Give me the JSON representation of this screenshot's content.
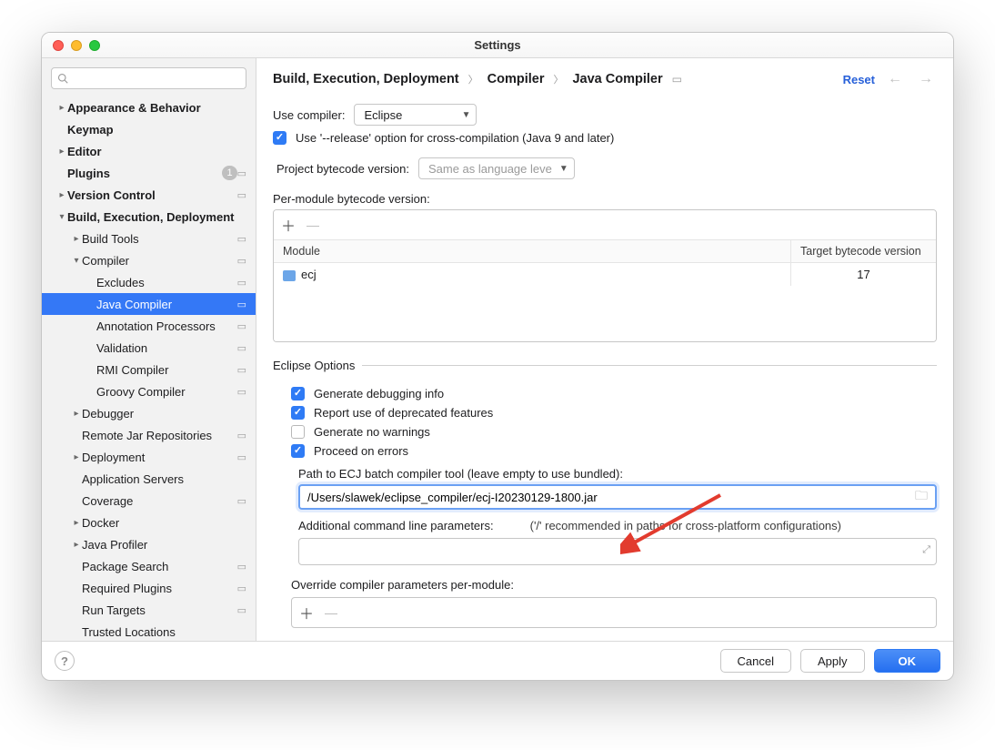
{
  "window": {
    "title": "Settings"
  },
  "crumbs": {
    "a": "Build, Execution, Deployment",
    "b": "Compiler",
    "c": "Java Compiler",
    "reset": "Reset"
  },
  "sidebar": {
    "search_placeholder": "",
    "items": [
      {
        "label": "Appearance & Behavior",
        "bold": true,
        "chev": "right",
        "indent": 0
      },
      {
        "label": "Keymap",
        "bold": true,
        "indent": 0
      },
      {
        "label": "Editor",
        "bold": true,
        "chev": "right",
        "indent": 0
      },
      {
        "label": "Plugins",
        "bold": true,
        "badge": "1",
        "cfg": true,
        "indent": 0
      },
      {
        "label": "Version Control",
        "bold": true,
        "cfg": true,
        "chev": "right",
        "indent": 0
      },
      {
        "label": "Build, Execution, Deployment",
        "bold": true,
        "chev": "down",
        "indent": 0
      },
      {
        "label": "Build Tools",
        "cfg": true,
        "chev": "right",
        "indent": 1
      },
      {
        "label": "Compiler",
        "cfg": true,
        "chev": "down",
        "indent": 1
      },
      {
        "label": "Excludes",
        "cfg": true,
        "indent": 2
      },
      {
        "label": "Java Compiler",
        "cfg": true,
        "indent": 2,
        "selected": true
      },
      {
        "label": "Annotation Processors",
        "cfg": true,
        "indent": 2
      },
      {
        "label": "Validation",
        "cfg": true,
        "indent": 2
      },
      {
        "label": "RMI Compiler",
        "cfg": true,
        "indent": 2
      },
      {
        "label": "Groovy Compiler",
        "cfg": true,
        "indent": 2
      },
      {
        "label": "Debugger",
        "chev": "right",
        "indent": 1
      },
      {
        "label": "Remote Jar Repositories",
        "cfg": true,
        "indent": 1
      },
      {
        "label": "Deployment",
        "cfg": true,
        "chev": "right",
        "indent": 1
      },
      {
        "label": "Application Servers",
        "indent": 1
      },
      {
        "label": "Coverage",
        "cfg": true,
        "indent": 1
      },
      {
        "label": "Docker",
        "chev": "right",
        "indent": 1
      },
      {
        "label": "Java Profiler",
        "chev": "right",
        "indent": 1
      },
      {
        "label": "Package Search",
        "cfg": true,
        "indent": 1
      },
      {
        "label": "Required Plugins",
        "cfg": true,
        "indent": 1
      },
      {
        "label": "Run Targets",
        "cfg": true,
        "indent": 1
      },
      {
        "label": "Trusted Locations",
        "indent": 1
      }
    ]
  },
  "compiler": {
    "use_compiler_label": "Use compiler:",
    "use_compiler_value": "Eclipse",
    "release_checkbox": "Use '--release' option for cross-compilation (Java 9 and later)",
    "project_bytecode_label": "Project bytecode version:",
    "project_bytecode_value": "Same as language leve",
    "per_module_label": "Per-module bytecode version:",
    "table": {
      "col_module": "Module",
      "col_version": "Target bytecode version",
      "rows": [
        {
          "module": "ecj",
          "version": "17"
        }
      ]
    }
  },
  "eclipse": {
    "legend": "Eclipse Options",
    "gen_debug": "Generate debugging info",
    "deprecated": "Report use of deprecated features",
    "no_warn": "Generate no warnings",
    "proceed": "Proceed on errors",
    "path_label": "Path to ECJ batch compiler tool (leave empty to use bundled):",
    "path_value": "/Users/slawek/eclipse_compiler/ecj-I20230129-1800.jar",
    "cmd_label": "Additional command line parameters:",
    "cmd_hint": "('/' recommended in paths for cross-platform configurations)",
    "override_label": "Override compiler parameters per-module:"
  },
  "footer": {
    "cancel": "Cancel",
    "apply": "Apply",
    "ok": "OK"
  },
  "glyph": {
    "plus": "＋",
    "minus": "—"
  }
}
